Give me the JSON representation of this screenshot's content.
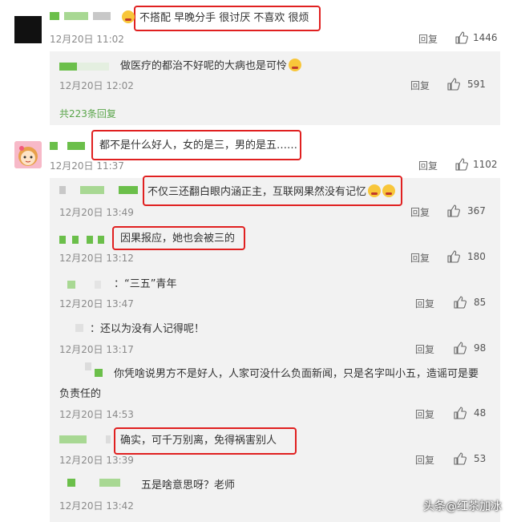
{
  "reply_label": "回复",
  "comments": [
    {
      "text": "不搭配 早晚分手 很讨厌 不喜欢 很烦",
      "time": "12月20日 11:02",
      "likes": "1446"
    },
    {
      "text": "都不是什么好人，女的是三，男的是五……",
      "time": "12月20日 11:37",
      "likes": "1102"
    }
  ],
  "replies": [
    {
      "text": "做医疗的都治不好呢的大病也是可怜",
      "time": "12月20日 12:02",
      "likes": "591"
    },
    {
      "text": "不仅三还翻白眼内涵正主，互联网果然没有记忆",
      "time": "12月20日 13:49",
      "likes": "367"
    },
    {
      "text": "因果报应，她也会被三的",
      "time": "12月20日 13:12",
      "likes": "180"
    },
    {
      "text": "：“三五”青年",
      "time": "12月20日 13:47",
      "likes": "85"
    },
    {
      "text": "：还以为没有人记得呢！",
      "time": "12月20日 13:17",
      "likes": "98"
    },
    {
      "text_line1": "你凭啥说男方不是好人，人家可没什么负面新闻，只是名字叫小五，造谣可是要",
      "text_line2": "负责任的",
      "time": "12月20日 14:53",
      "likes": "48"
    },
    {
      "text": "确实，可千万别离，免得祸害别人",
      "time": "12月20日 13:39",
      "likes": "53"
    },
    {
      "text": "五是啥意思呀？老师",
      "time": "12月20日 13:42"
    }
  ],
  "more_replies": "共223条回复",
  "watermark": "头条@红茶加冰",
  "colors": {
    "highlight": "#e02020",
    "username": "#6bbf4a",
    "link": "#5aa54a"
  }
}
